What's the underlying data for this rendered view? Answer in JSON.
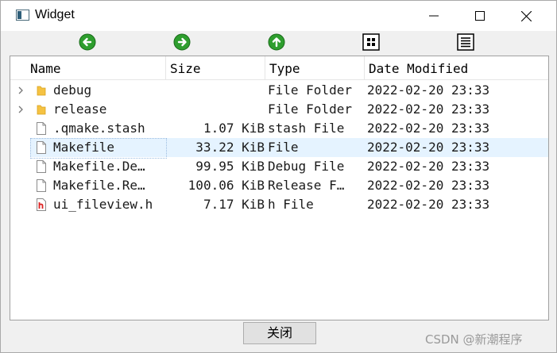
{
  "window": {
    "title": "Widget",
    "icons": {
      "app": "app-window-icon",
      "minimize": "minimize-icon",
      "maximize": "maximize-icon",
      "close": "close-icon"
    }
  },
  "toolbar": {
    "buttons": [
      {
        "icon": "back-arrow-icon",
        "color": "#2e9e2e"
      },
      {
        "icon": "forward-arrow-icon",
        "color": "#2e9e2e"
      },
      {
        "icon": "up-arrow-icon",
        "color": "#2e9e2e"
      },
      {
        "icon": "list-view-icon"
      },
      {
        "icon": "detail-view-icon"
      }
    ]
  },
  "fileview": {
    "columns": [
      "Name",
      "Size",
      "Type",
      "Date Modified"
    ],
    "rows": [
      {
        "name": "debug",
        "size": "",
        "type": "File Folder",
        "date": "2022-02-20 23:33",
        "icon": "folder-icon",
        "expandable": true
      },
      {
        "name": "release",
        "size": "",
        "type": "File Folder",
        "date": "2022-02-20 23:33",
        "icon": "folder-icon",
        "expandable": true
      },
      {
        "name": ".qmake.stash",
        "size": "1.07 KiB",
        "type": "stash File",
        "date": "2022-02-20 23:33",
        "icon": "file-icon",
        "expandable": false
      },
      {
        "name": "Makefile",
        "size": "33.22 KiB",
        "type": "File",
        "date": "2022-02-20 23:33",
        "icon": "file-icon",
        "expandable": false,
        "selected": true
      },
      {
        "name": "Makefile.De…",
        "size": "99.95 KiB",
        "type": "Debug File",
        "date": "2022-02-20 23:33",
        "icon": "file-icon",
        "expandable": false
      },
      {
        "name": "Makefile.Re…",
        "size": "100.06 KiB",
        "type": "Release F…",
        "date": "2022-02-20 23:33",
        "icon": "file-icon",
        "expandable": false
      },
      {
        "name": "ui_fileview.h",
        "size": "7.17 KiB",
        "type": "h File",
        "date": "2022-02-20 23:33",
        "icon": "header-file-icon",
        "expandable": false
      }
    ],
    "colors": {
      "selection": "#e5f3ff",
      "folder": "#f5c242"
    }
  },
  "close_button": {
    "label": "关闭"
  },
  "watermark": "CSDN @新潮程序"
}
